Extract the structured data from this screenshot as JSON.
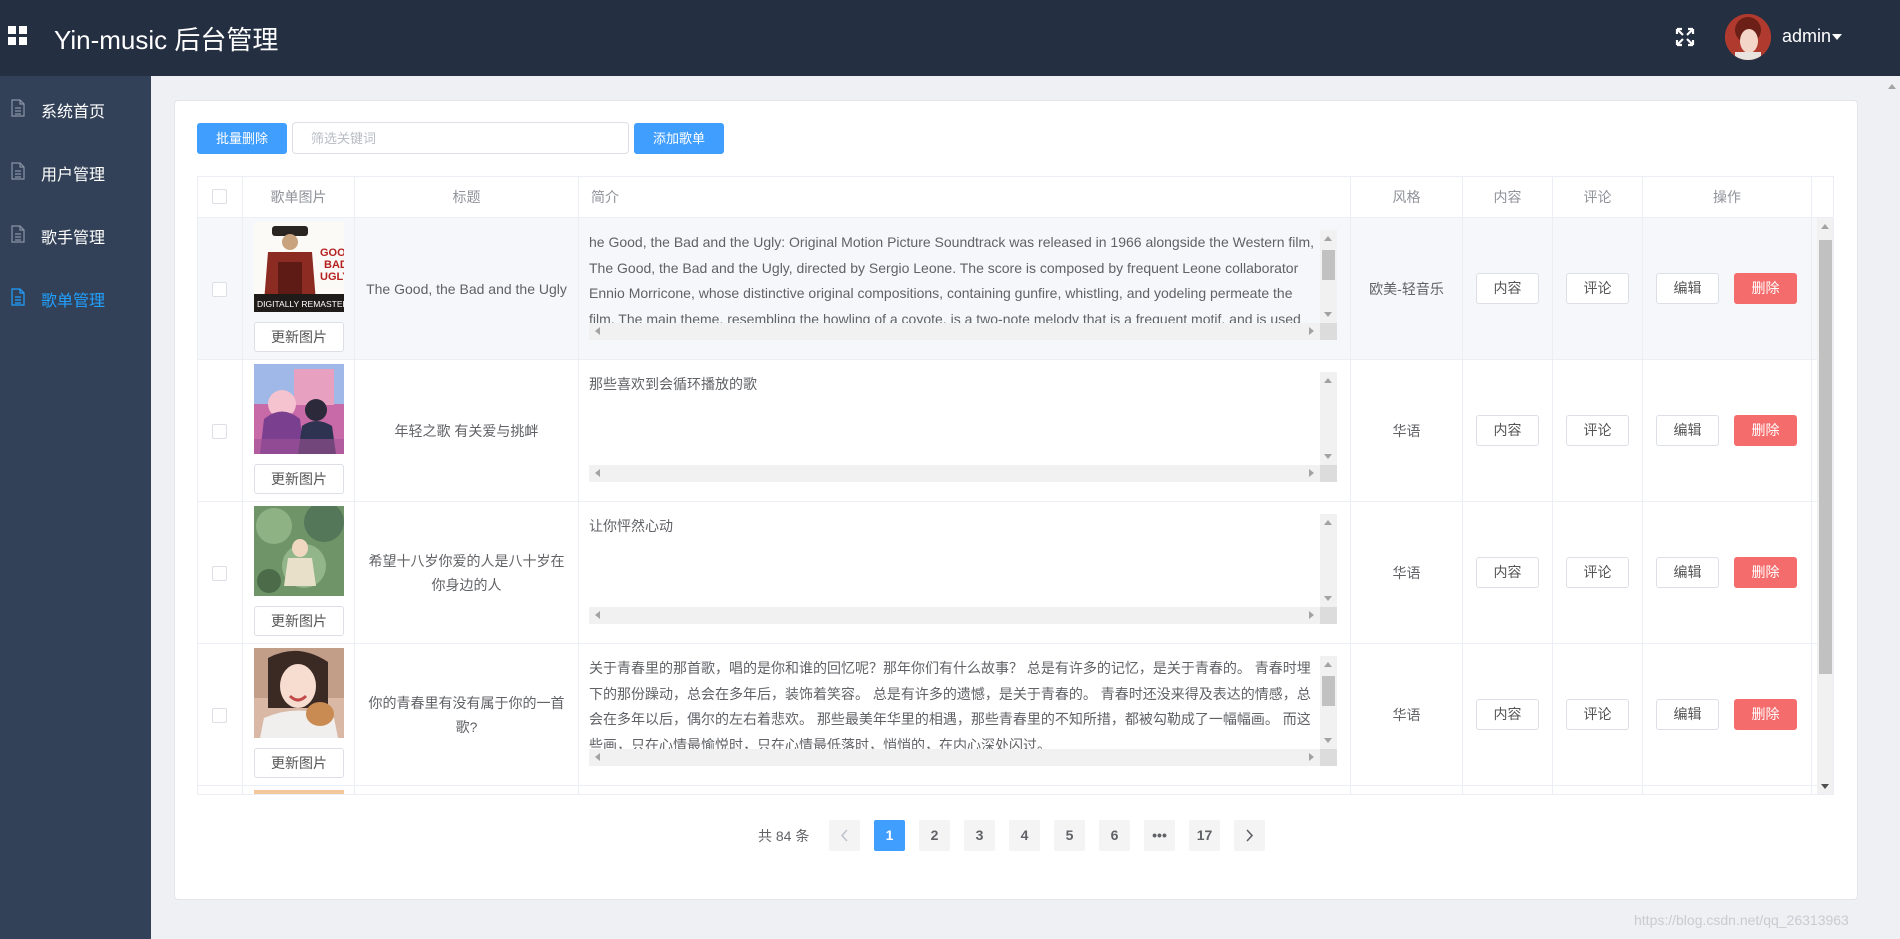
{
  "header": {
    "title": "Yin-music 后台管理",
    "username": "admin"
  },
  "sidebar": {
    "items": [
      {
        "label": "系统首页"
      },
      {
        "label": "用户管理"
      },
      {
        "label": "歌手管理"
      },
      {
        "label": "歌单管理",
        "active": true
      }
    ]
  },
  "toolbar": {
    "batch_delete_label": "批量删除",
    "filter_placeholder": "筛选关键词",
    "add_label": "添加歌单"
  },
  "table": {
    "headers": [
      "歌单图片",
      "标题",
      "简介",
      "风格",
      "内容",
      "评论",
      "操作"
    ],
    "update_image_label": "更新图片",
    "content_label": "内容",
    "comment_label": "评论",
    "edit_label": "编辑",
    "delete_label": "删除",
    "rows": [
      {
        "title": "The Good, the Bad and the Ugly",
        "intro": "he Good, the Bad and the Ugly: Original Motion Picture Soundtrack was released in 1966 alongside the Western film, The Good, the Bad and the Ugly, directed by Sergio Leone. The score is composed by frequent Leone collaborator Ennio Morricone, whose distinctive original compositions, containing gunfire, whistling, and yodeling permeate the film. The main theme, resembling the howling of a coyote, is a two-note melody that is a frequent motif, and is used for the three main chara",
        "style": "欧美-轻音乐",
        "cover_text": "DIGITALLY REMASTERED"
      },
      {
        "title": "年轻之歌 有关爱与挑衅",
        "intro": "那些喜欢到会循环播放的歌",
        "style": "华语"
      },
      {
        "title": "希望十八岁你爱的人是八十岁在你身边的人",
        "intro": "让你怦然心动",
        "style": "华语"
      },
      {
        "title": "你的青春里有没有属于你的一首歌?",
        "intro": "关于青春里的那首歌，唱的是你和谁的回忆呢？那年你们有什么故事？ 总是有许多的记忆，是关于青春的。 青春时埋下的那份躁动，总会在多年后，装饰着笑容。 总是有许多的遗憾，是关于青春的。 青春时还没来得及表达的情感，总会在多年以后，偶尔的左右着悲欢。 那些最美年华里的相遇，那些青春里的不知所措，都被勾勒成了一幅幅画。 而这些画，只在心情最愉悦时，只在心情最低落时，悄悄的，在内心深处闪过。",
        "style": "华语"
      }
    ]
  },
  "pagination": {
    "total": "共 84 条",
    "pages": [
      "1",
      "2",
      "3",
      "4",
      "5",
      "6",
      "•••",
      "17"
    ],
    "current": "1"
  },
  "watermark": "https://blog.csdn.net/qq_26313963",
  "colors": {
    "header_bg": "#242f42",
    "sidebar_bg": "#324157",
    "primary": "#409eff",
    "danger": "#f56c6c",
    "active_menu": "#20a0ff"
  }
}
